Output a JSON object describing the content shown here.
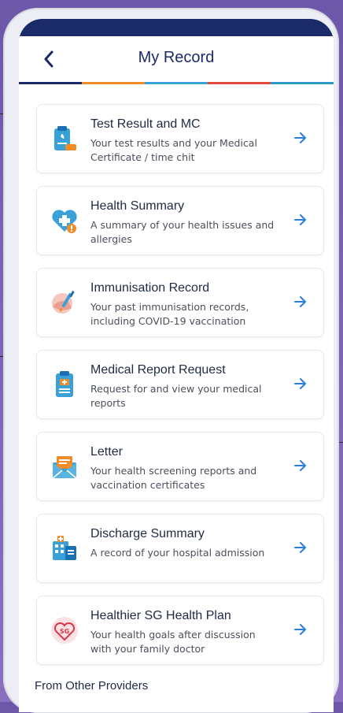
{
  "header": {
    "title": "My Record"
  },
  "stripe_colors": [
    "#1b2b6a",
    "#f28c28",
    "#3aa0d8",
    "#e2493f",
    "#2e9ac9"
  ],
  "records": [
    {
      "title": "Test Result and MC",
      "description": "Your test results and your Medical Certificate / time chit",
      "icon": "test-result-icon"
    },
    {
      "title": "Health Summary",
      "description": "A summary of your health issues and allergies",
      "icon": "health-summary-icon"
    },
    {
      "title": "Immunisation Record",
      "description": "Your past immunisation records, including COVID-19 vaccination",
      "icon": "immunisation-icon"
    },
    {
      "title": "Medical Report Request",
      "description": "Request for and view your medical reports",
      "icon": "medical-report-icon"
    },
    {
      "title": "Letter",
      "description": "Your health screening reports and vaccination certificates",
      "icon": "letter-icon"
    },
    {
      "title": "Discharge Summary",
      "description": "A record of your hospital admission",
      "icon": "discharge-summary-icon"
    },
    {
      "title": "Healthier SG Health Plan",
      "description": "Your health goals after discussion with your family doctor",
      "icon": "healthier-sg-icon",
      "badge_text": "SG"
    }
  ],
  "section": {
    "other_providers": "From Other Providers"
  },
  "colors": {
    "accent": "#1b2b6a",
    "arrow": "#2b7fd4"
  }
}
